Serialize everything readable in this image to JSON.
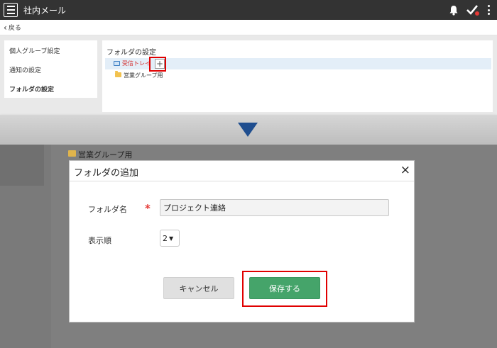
{
  "app": {
    "title": "社内メール"
  },
  "nav": {
    "back_label": "戻る"
  },
  "sidebar": {
    "items": [
      {
        "label": "個人グループ設定",
        "active": false
      },
      {
        "label": "通知の設定",
        "active": false
      },
      {
        "label": "フォルダの設定",
        "active": true
      }
    ]
  },
  "main": {
    "title": "フォルダの設定",
    "tree": [
      {
        "label": "受信トレイ",
        "icon": "tray-icon",
        "selected": true
      },
      {
        "label": "営業グループ用",
        "icon": "folder-icon"
      }
    ],
    "add_button_label": "+"
  },
  "background": {
    "folder_label": "営業グループ用"
  },
  "modal": {
    "title": "フォルダの追加",
    "close_label": "×",
    "name_label": "フォルダ名",
    "required_mark": "*",
    "name_value": "プロジェクト連絡",
    "order_label": "表示順",
    "order_value": "2",
    "cancel_label": "キャンセル",
    "save_label": "保存する"
  },
  "colors": {
    "header_bg": "#333333",
    "accent_red": "#e00000",
    "save_green": "#45a46a",
    "arrow_blue": "#1f4e8f"
  }
}
